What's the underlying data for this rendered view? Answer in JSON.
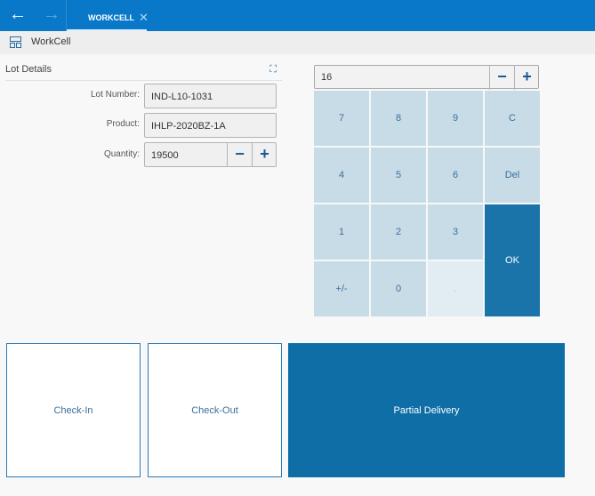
{
  "header": {
    "back_icon": "arrow-left-icon",
    "forward_icon": "arrow-right-icon",
    "tab_label": "WORKCELL",
    "tab_close": "✕"
  },
  "toolbar": {
    "title": "WorkCell",
    "icon": "layout-icon"
  },
  "lot_details": {
    "title": "Lot Details",
    "expand_icon": "expand-icon",
    "lot_number_label": "Lot Number:",
    "lot_number": "IND-L10-1031",
    "product_label": "Product:",
    "product": "IHLP-2020BZ-1A",
    "quantity_label": "Quantity:",
    "quantity": "19500",
    "minus": "−",
    "plus": "+"
  },
  "keypad": {
    "value": "16",
    "minus": "−",
    "plus": "+",
    "keys": [
      "7",
      "8",
      "9",
      "C",
      "4",
      "5",
      "6",
      "Del",
      "1",
      "2",
      "3",
      "+/-",
      "0",
      "."
    ],
    "ok": "OK"
  },
  "actions": {
    "check_in": "Check-In",
    "check_out": "Check-Out",
    "partial": "Partial Delivery"
  },
  "colors": {
    "header": "#0a78c8",
    "accent": "#0f6ea6",
    "key": "#c8dce8"
  }
}
